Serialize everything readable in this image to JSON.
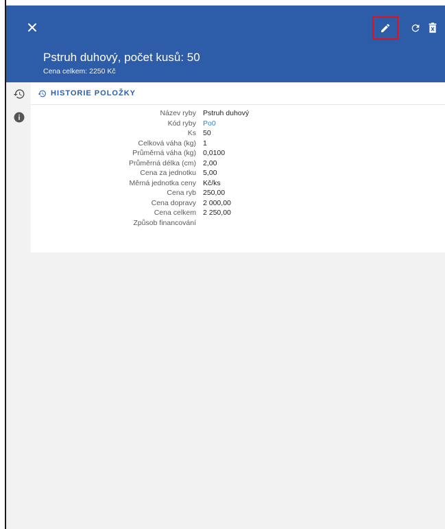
{
  "header": {
    "title": "Pstruh duhový, počet kusů: 50",
    "subtitle": "Cena celkem: 2250 Kč",
    "icons": [
      "close-icon",
      "edit-icon",
      "refresh-icon",
      "delete-icon"
    ],
    "color": "#2d5ca8",
    "highlight_color": "#e6101a"
  },
  "sidebar": {
    "icons": [
      "history-icon",
      "info-icon"
    ]
  },
  "section": {
    "title": "HISTORIE POLOŽKY",
    "accent": "#2d5ca8",
    "link_color": "#2a86d4"
  },
  "details": [
    {
      "label": "Název ryby",
      "value": "Pstruh duhový"
    },
    {
      "label": "Kód ryby",
      "value": "Po0"
    },
    {
      "label": "Ks",
      "value": "50"
    },
    {
      "label": "Celková váha (kg)",
      "value": "1"
    },
    {
      "label": "Průměrná váha (kg)",
      "value": "0,0100"
    },
    {
      "label": "Průměrná délka (cm)",
      "value": "2,00"
    },
    {
      "label": "Cena za jednotku",
      "value": "5,00"
    },
    {
      "label": "Měrná jednotka ceny",
      "value": "Kč/ks"
    },
    {
      "label": "Cena ryb",
      "value": "250,00"
    },
    {
      "label": "Cena dopravy",
      "value": "2 000,00"
    },
    {
      "label": "Cena celkem",
      "value": "2 250,00"
    },
    {
      "label": "Způsob financování",
      "value": ""
    }
  ]
}
